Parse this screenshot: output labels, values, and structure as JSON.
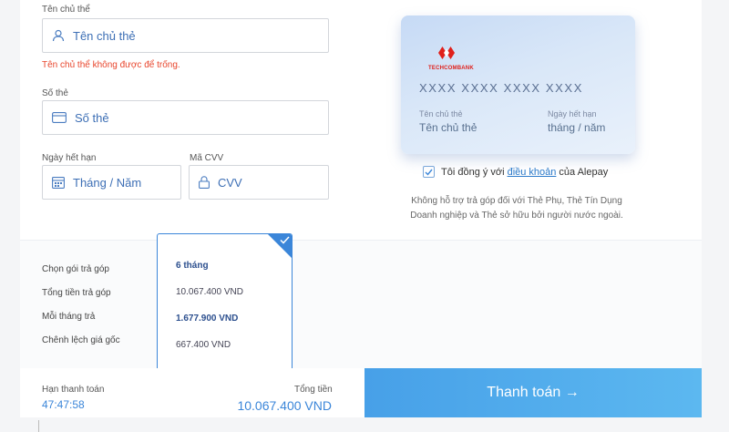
{
  "form": {
    "holder_label": "Tên chủ thể",
    "holder_placeholder": "Tên chủ thẻ",
    "holder_error": "Tên chủ thể không được để trống.",
    "card_number_label": "Số thẻ",
    "card_number_placeholder": "Số thẻ",
    "expiry_label": "Ngày hết hạn",
    "expiry_placeholder": "Tháng / Năm",
    "cvv_label": "Mã CVV",
    "cvv_placeholder": "CVV"
  },
  "card": {
    "bank_name": "TECHCOMBANK",
    "number": "XXXX XXXX XXXX XXXX",
    "holder_label": "Tên chủ thẻ",
    "holder_value": "Tên chủ thẻ",
    "expiry_label": "Ngày hết hạn",
    "expiry_value": "tháng / năm",
    "brand_color": "#e0201b"
  },
  "agreement": {
    "checked": true,
    "prefix": "Tôi đồng ý với",
    "link": "điều khoản",
    "suffix": "của Alepay"
  },
  "note": "Không hỗ trợ trả góp đối với Thẻ Phụ, Thẻ Tín Dụng Doanh nghiệp và Thẻ sở hữu bởi người nước ngoài.",
  "installment": {
    "labels": [
      "Chọn gói trả góp",
      "Tổng tiền trả góp",
      "Mỗi tháng trả",
      "Chênh lệch giá gốc"
    ],
    "plan": {
      "term": "6 tháng",
      "total": "10.067.400 VND",
      "monthly": "1.677.900 VND",
      "difference": "667.400 VND",
      "selected": true
    }
  },
  "footer": {
    "deadline_label": "Hạn thanh toán",
    "deadline_value": "47:47:58",
    "total_label": "Tổng tiền",
    "total_value": "10.067.400 VND",
    "pay_button": "Thanh toán →"
  },
  "colors": {
    "accent": "#3b86d9",
    "error": "#e8452c",
    "button": "#52aaec"
  }
}
